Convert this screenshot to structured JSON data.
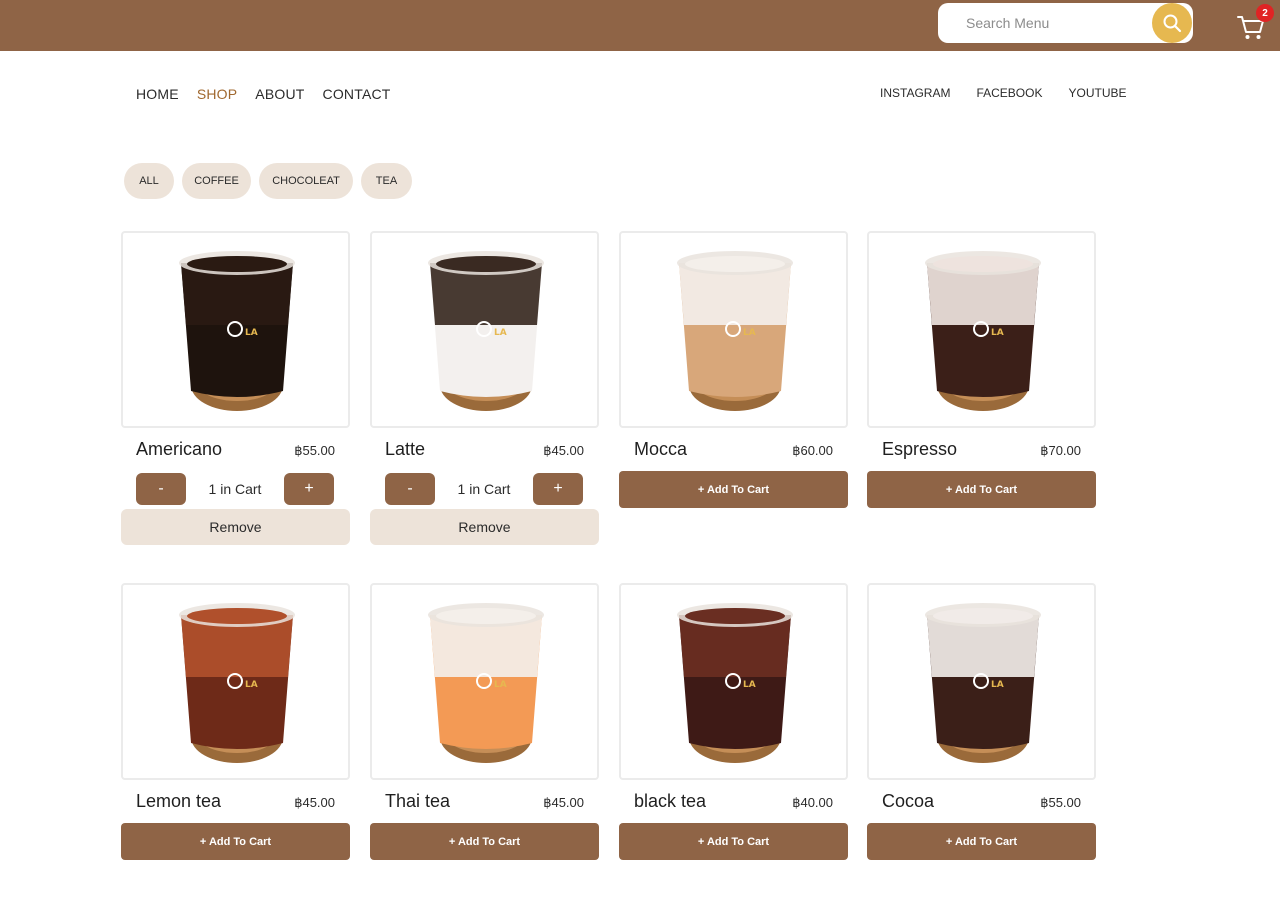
{
  "header": {
    "search_placeholder": "Search Menu",
    "cart_count": "2",
    "colors": {
      "bar": "#8f6446",
      "search_button": "#e6b850",
      "badge": "#e02424"
    }
  },
  "nav": {
    "links": [
      "HOME",
      "SHOP",
      "ABOUT",
      "CONTACT"
    ],
    "active": "SHOP",
    "social": [
      "INSTAGRAM",
      "FACEBOOK",
      "YOUTUBE"
    ]
  },
  "filters": [
    "ALL",
    "COFFEE",
    "CHOCOLEAT",
    "TEA"
  ],
  "labels": {
    "add_to_cart": "+ Add To Cart",
    "remove": "Remove",
    "minus": "-",
    "plus": "+"
  },
  "products": [
    {
      "name": "Americano",
      "price": "฿55.00",
      "in_cart": "1 in Cart",
      "drink_colors": [
        "#2a1a12",
        "#1e130d"
      ]
    },
    {
      "name": "Latte",
      "price": "฿45.00",
      "in_cart": "1 in Cart",
      "drink_colors": [
        "#3a2a22",
        "#f3f0ee"
      ]
    },
    {
      "name": "Mocca",
      "price": "฿60.00",
      "in_cart": "",
      "drink_colors": [
        "#f4efea",
        "#d8a77a"
      ]
    },
    {
      "name": "Espresso",
      "price": "฿70.00",
      "in_cart": "",
      "drink_colors": [
        "#eee3de",
        "#3b1f18"
      ]
    },
    {
      "name": "Lemon tea",
      "price": "฿45.00",
      "in_cart": "",
      "drink_colors": [
        "#b0502c",
        "#6e2a18"
      ]
    },
    {
      "name": "Thai tea",
      "price": "฿45.00",
      "in_cart": "",
      "drink_colors": [
        "#f4efea",
        "#f39a55"
      ]
    },
    {
      "name": "black tea",
      "price": "฿40.00",
      "in_cart": "",
      "drink_colors": [
        "#6a2e22",
        "#3e1a16"
      ]
    },
    {
      "name": "Cocoa",
      "price": "฿55.00",
      "in_cart": "",
      "drink_colors": [
        "#f1ebe8",
        "#3b1f18"
      ]
    }
  ]
}
